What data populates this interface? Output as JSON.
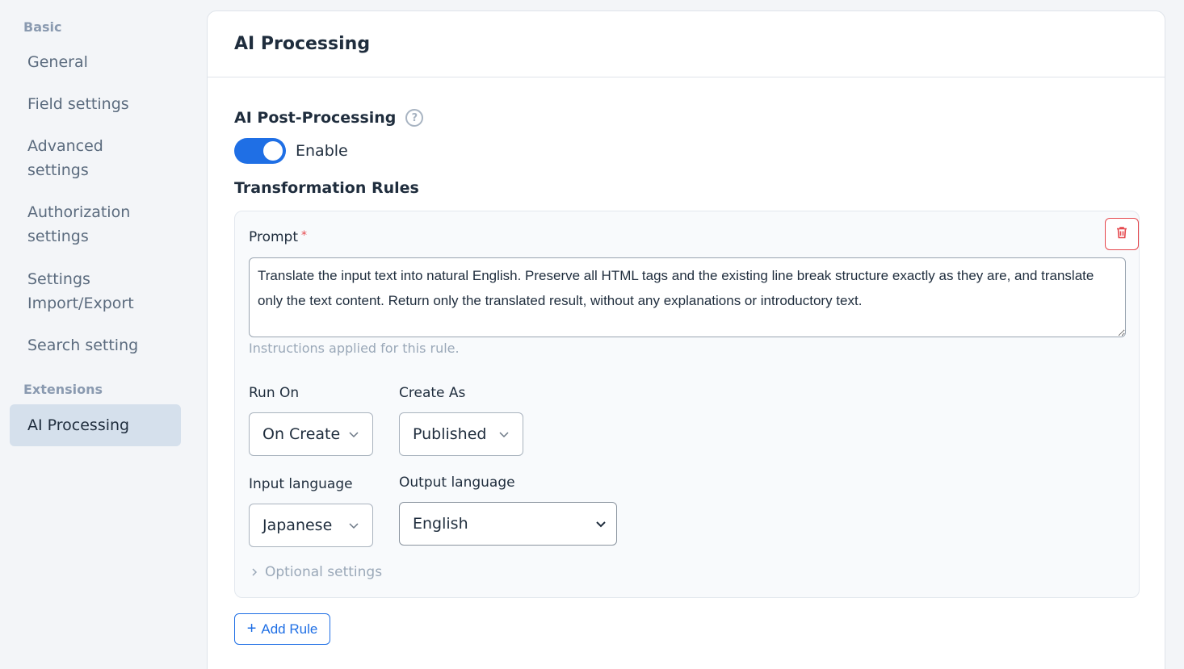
{
  "sidebar": {
    "sections": [
      {
        "label": "Basic"
      },
      {
        "label": "Extensions"
      }
    ],
    "items": [
      {
        "label": "General"
      },
      {
        "label": "Field settings"
      },
      {
        "label": "Advanced\nsettings"
      },
      {
        "label": "Authorization\nsettings"
      },
      {
        "label": "Settings\nImport/Export"
      },
      {
        "label": "Search setting"
      },
      {
        "label": "AI Processing"
      }
    ]
  },
  "panel": {
    "title": "AI Processing",
    "ai_post_processing_label": "AI Post-Processing",
    "help_icon": "question-circle-icon",
    "toggle": {
      "label": "Enable",
      "on": true,
      "color": "#1f6fe5"
    },
    "rules_title": "Transformation Rules",
    "rule": {
      "prompt_label": "Prompt",
      "required_mark": "*",
      "prompt_value": "Translate the input text into natural English. Preserve all HTML tags and the existing line break structure exactly as they are, and translate only the text content. Return only the translated result, without any explanations or introductory text.",
      "prompt_hint": "Instructions applied for this rule.",
      "run_on_label": "Run On",
      "run_on_value": "On Create",
      "create_as_label": "Create As",
      "create_as_value": "Published",
      "input_language_label": "Input language",
      "input_language_value": "Japanese",
      "output_language_label": "Output language",
      "output_language_value": "English",
      "optional_settings_label": "Optional settings",
      "delete_icon": "trash-icon"
    },
    "add_rule_label": "Add Rule"
  }
}
